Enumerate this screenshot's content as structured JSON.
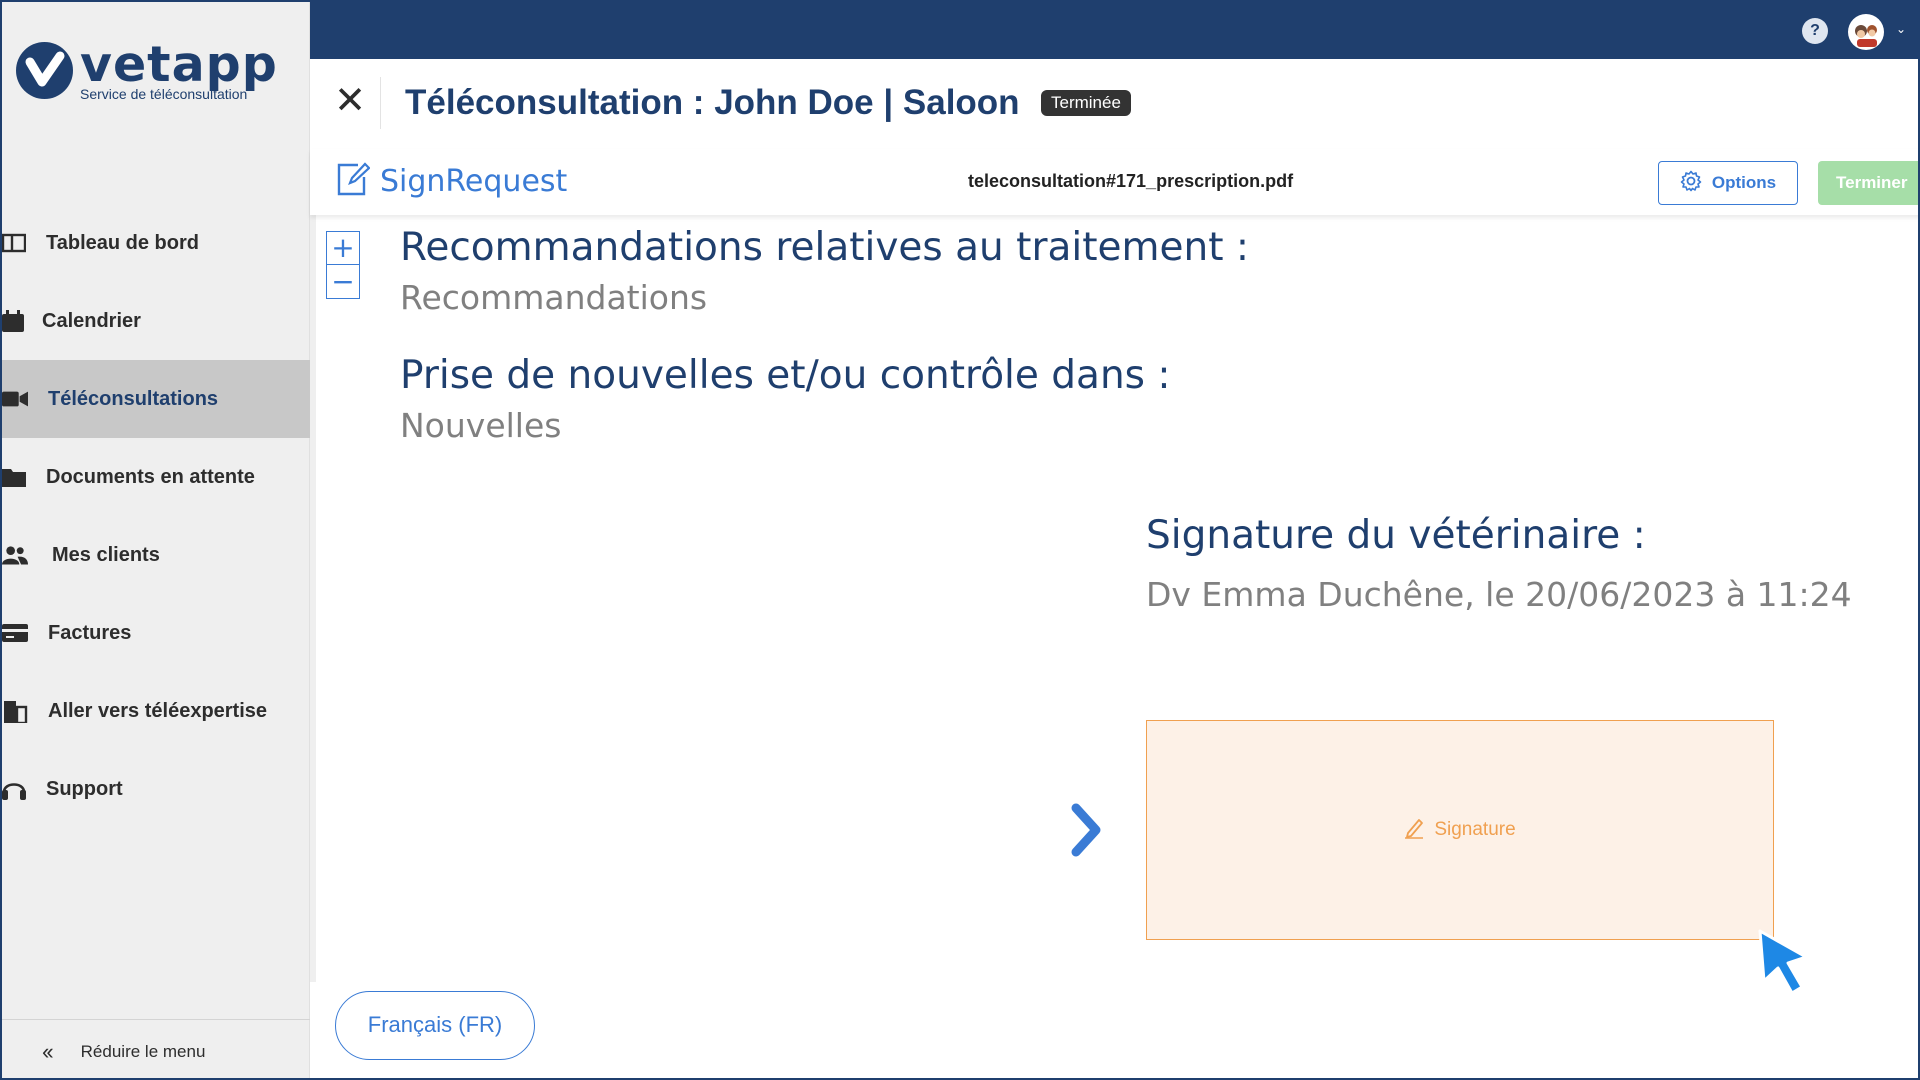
{
  "brand": {
    "name": "vetapp",
    "tagline": "Service de téléconsultation",
    "color": "#1f3f6e"
  },
  "sidebar": {
    "items": [
      {
        "label": "Tableau de bord",
        "icon": "dashboard-icon",
        "active": false
      },
      {
        "label": "Calendrier",
        "icon": "calendar-icon",
        "active": false
      },
      {
        "label": "Téléconsultations",
        "icon": "video-camera-icon",
        "active": true
      },
      {
        "label": "Documents en attente",
        "icon": "folder-icon",
        "active": false
      },
      {
        "label": "Mes clients",
        "icon": "users-icon",
        "active": false
      },
      {
        "label": "Factures",
        "icon": "credit-card-icon",
        "active": false
      },
      {
        "label": "Aller vers téléexpertise",
        "icon": "building-icon",
        "active": false
      },
      {
        "label": "Support",
        "icon": "headset-icon",
        "active": false
      }
    ],
    "collapse_label": "Réduire le menu",
    "collapse_icon": "double-chevron-left-icon"
  },
  "topbar": {
    "help_icon": "question-icon",
    "help_label": "?",
    "avatar_icon": "avatar-icon",
    "caret_icon": "chevron-down-icon"
  },
  "header": {
    "close_label": "✕",
    "title": "Téléconsultation : John Doe | Saloon",
    "status": "Terminée"
  },
  "doc_toolbar": {
    "provider": "SignRequest",
    "filename": "teleconsultation#171_prescription.pdf",
    "options_label": "Options",
    "finish_label": "Terminer"
  },
  "document": {
    "zoom_in": "+",
    "zoom_out": "−",
    "sections": [
      {
        "heading": "Recommandations relatives au traitement :",
        "value": "Recommandations"
      },
      {
        "heading": "Prise de nouvelles et/ou contrôle dans :",
        "value": "Nouvelles"
      }
    ],
    "signature_heading": "Signature du vétérinaire :",
    "signature_meta": "Dv Emma Duchêne, le 20/06/2023 à 11:24",
    "signature_field_label": "Signature"
  },
  "language": {
    "label": "Français  (FR)"
  },
  "colors": {
    "primary": "#1f3f6e",
    "accent": "#3a7bd5",
    "finish": "#a6dea8",
    "signature_border": "#f0a050",
    "signature_bg": "#fdf1e7"
  }
}
